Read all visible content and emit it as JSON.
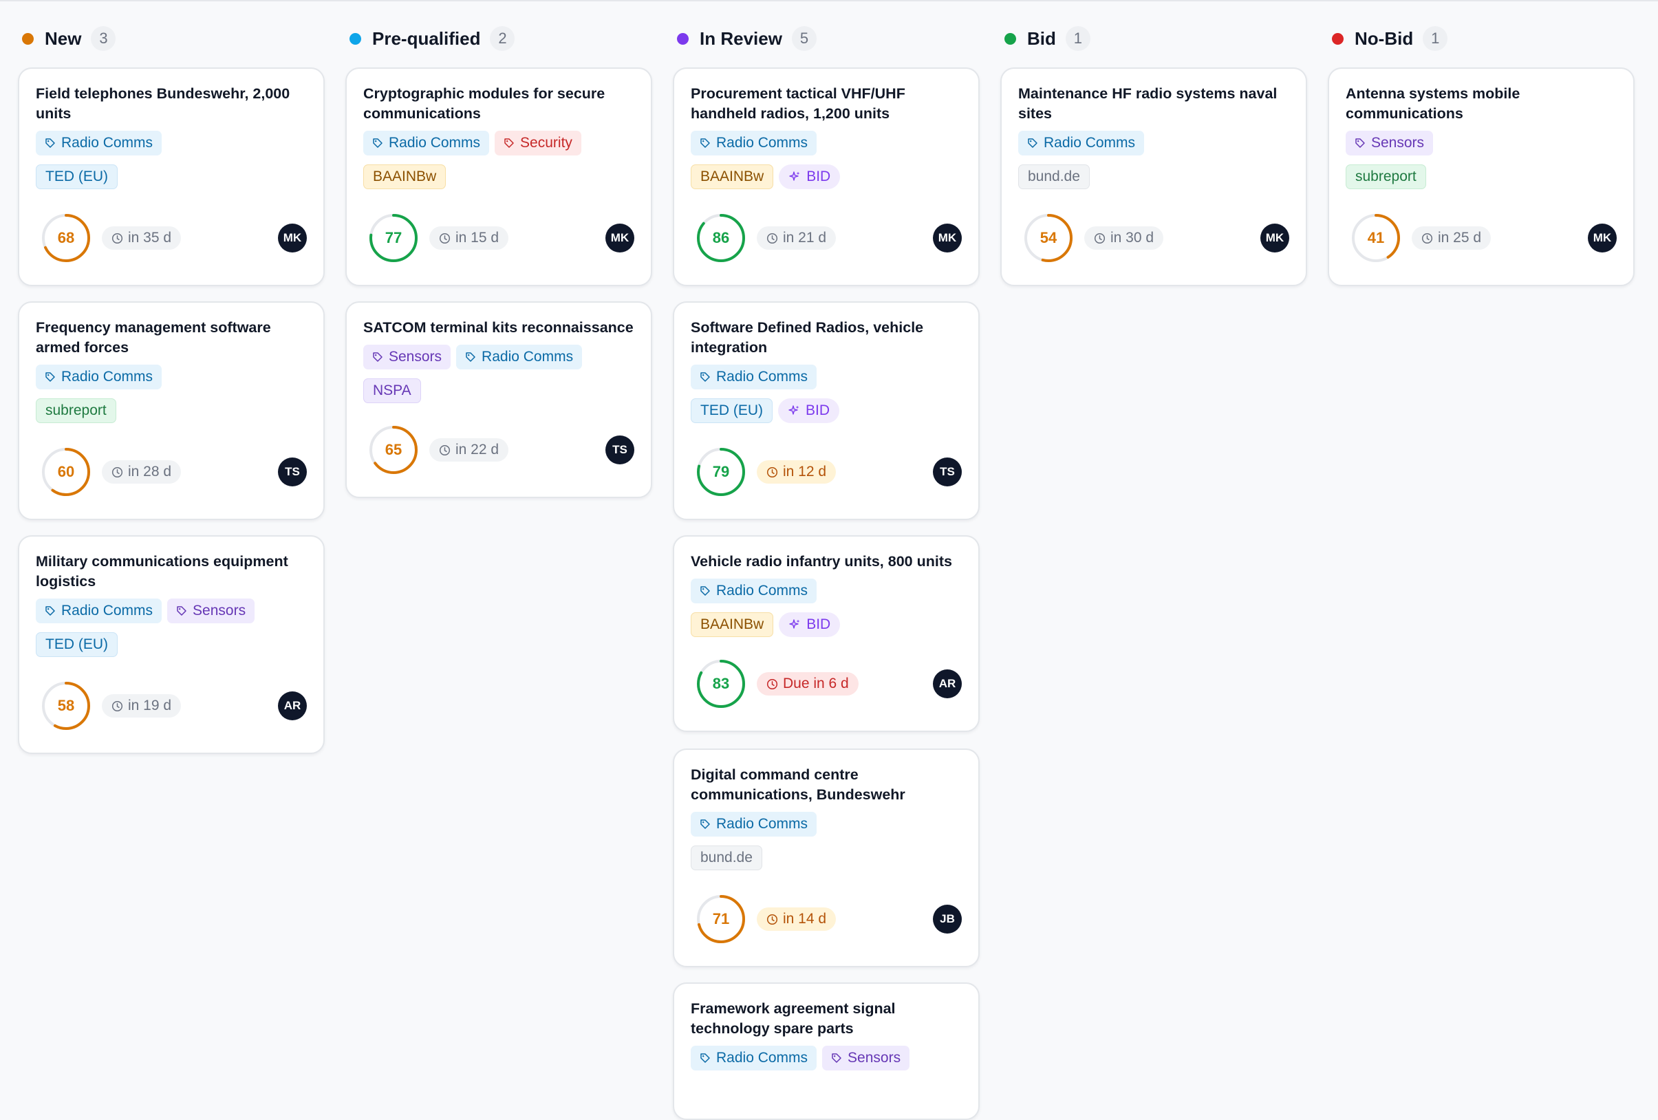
{
  "colors": {
    "new": "#d97706",
    "prequalified": "#0ea5e9",
    "in_review": "#7c3aed",
    "bid": "#16a34a",
    "no_bid": "#dc2626",
    "score_high": "#16a34a",
    "score_mid": "#d97706",
    "score_track": "#e5e7eb"
  },
  "columns": [
    {
      "title": "New",
      "count": "3",
      "dot_color": "#d97706",
      "cards": [
        {
          "title": "Field telephones Bundeswehr, 2,000 units",
          "tags": [
            "Radio Comms"
          ],
          "source": "TED (EU)",
          "bid": false,
          "score": 68,
          "due": "in 35 d",
          "due_state": "normal",
          "avatar": "MK"
        },
        {
          "title": "Frequency management software armed forces",
          "tags": [
            "Radio Comms"
          ],
          "source": "subreport",
          "bid": false,
          "score": 60,
          "due": "in 28 d",
          "due_state": "normal",
          "avatar": "TS"
        },
        {
          "title": "Military communications equipment logistics",
          "tags": [
            "Radio Comms",
            "Sensors"
          ],
          "source": "TED (EU)",
          "bid": false,
          "score": 58,
          "due": "in 19 d",
          "due_state": "normal",
          "avatar": "AR"
        }
      ]
    },
    {
      "title": "Pre-qualified",
      "count": "2",
      "dot_color": "#0ea5e9",
      "cards": [
        {
          "title": "Cryptographic modules for secure communications",
          "tags": [
            "Radio Comms",
            "Security"
          ],
          "source": "BAAINBw",
          "bid": false,
          "score": 77,
          "due": "in 15 d",
          "due_state": "normal",
          "avatar": "MK"
        },
        {
          "title": "SATCOM terminal kits reconnaissance",
          "tags": [
            "Sensors",
            "Radio Comms"
          ],
          "source": "NSPA",
          "bid": false,
          "score": 65,
          "due": "in 22 d",
          "due_state": "normal",
          "avatar": "TS"
        }
      ]
    },
    {
      "title": "In Review",
      "count": "5",
      "dot_color": "#7c3aed",
      "cards": [
        {
          "title": "Procurement tactical VHF/UHF handheld radios, 1,200 units",
          "tags": [
            "Radio Comms"
          ],
          "source": "BAAINBw",
          "bid": true,
          "score": 86,
          "due": "in 21 d",
          "due_state": "normal",
          "avatar": "MK"
        },
        {
          "title": "Software Defined Radios, vehicle integration",
          "tags": [
            "Radio Comms"
          ],
          "source": "TED (EU)",
          "bid": true,
          "score": 79,
          "due": "in 12 d",
          "due_state": "warn",
          "avatar": "TS"
        },
        {
          "title": "Vehicle radio infantry units, 800 units",
          "tags": [
            "Radio Comms"
          ],
          "source": "BAAINBw",
          "bid": true,
          "score": 83,
          "due": "Due in 6 d",
          "due_state": "danger",
          "avatar": "AR"
        },
        {
          "title": "Digital command centre communications, Bundeswehr",
          "tags": [
            "Radio Comms"
          ],
          "source": "bund.de",
          "bid": false,
          "score": 71,
          "due": "in 14 d",
          "due_state": "warn",
          "avatar": "JB"
        },
        {
          "title": "Framework agreement signal technology spare parts",
          "tags": [
            "Radio Comms",
            "Sensors"
          ],
          "source": "",
          "bid": false,
          "score": null,
          "due": "",
          "due_state": "normal",
          "avatar": ""
        }
      ]
    },
    {
      "title": "Bid",
      "count": "1",
      "dot_color": "#16a34a",
      "cards": [
        {
          "title": "Maintenance HF radio systems naval sites",
          "tags": [
            "Radio Comms"
          ],
          "source": "bund.de",
          "bid": false,
          "score": 54,
          "due": "in 30 d",
          "due_state": "normal",
          "avatar": "MK"
        }
      ]
    },
    {
      "title": "No-Bid",
      "count": "1",
      "dot_color": "#dc2626",
      "cards": [
        {
          "title": "Antenna systems mobile communications",
          "tags": [
            "Sensors"
          ],
          "source": "subreport",
          "bid": false,
          "score": 41,
          "due": "in 25 d",
          "due_state": "normal",
          "avatar": "MK"
        }
      ]
    }
  ],
  "labels": {
    "bid_badge": "BID"
  }
}
